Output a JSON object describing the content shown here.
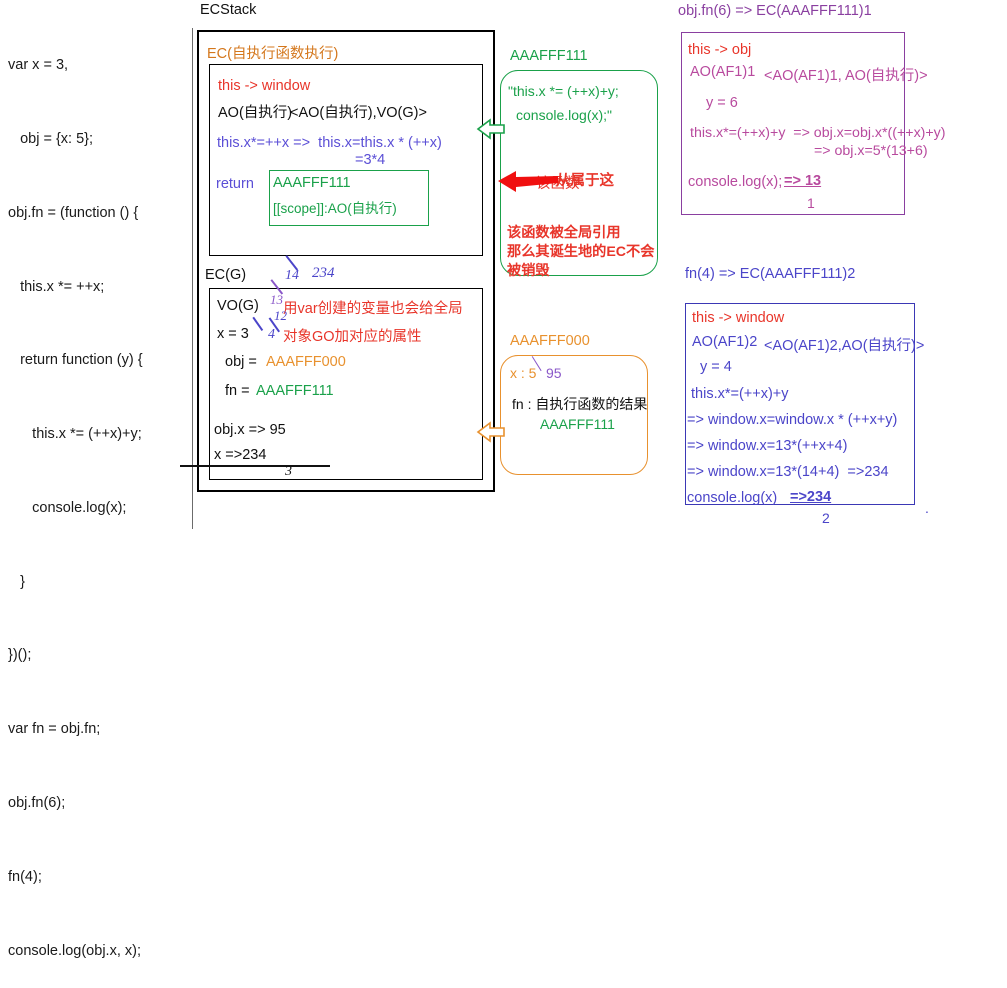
{
  "code_panel": {
    "lines": [
      "var x = 3,",
      "   obj = {x: 5};",
      "obj.fn = (function () {",
      "   this.x *= ++x;",
      "   return function (y) {",
      "      this.x *= (++x)+y;",
      "      console.log(x);",
      "   }",
      "})();",
      "var fn = obj.fn;",
      "obj.fn(6);",
      "fn(4);",
      "console.log(obj.x, x);"
    ]
  },
  "ecstack": {
    "title": "ECStack",
    "ec_self": {
      "label": "EC(自执行函数执行)",
      "this_binding": "this -> window",
      "ao": "AO(自执行)",
      "scope_chain": "<AO(自执行),VO(G)>",
      "expr": "this.x*=++x =>  this.x=this.x * (++x)",
      "expr_result": "=3*4",
      "return_keyword": "return",
      "return_fn_name": "AAAFFF111",
      "return_fn_scope": "[[scope]]:AO(自执行)",
      "belongs_note": "从属于这"
    },
    "ec_g": {
      "label": "EC(G)",
      "vo": "VO(G)",
      "note_line1": "用var创建的变量也会给全局",
      "note_line2": "对象GO加对应的属性",
      "x_line": "x = 3",
      "obj_key": "obj = ",
      "obj_value": "AAAFFF000",
      "fn_key": "fn = ",
      "fn_value": "AAAFFF111",
      "result_objx": "obj.x => 95",
      "result_x": "x =>234",
      "annotations": {
        "a14": "14",
        "a234": "234",
        "a13": "13",
        "a12": "12",
        "a4": "4",
        "a3_bottom": "3"
      }
    }
  },
  "fn111": {
    "label": "AAAFFF111",
    "body_line1": "\"this.x *= (++x)+y;",
    "body_line2": "console.log(x);\"",
    "pointer_label": "该函数",
    "note": "该函数被全局引用\n那么其诞生地的EC不会\n被销毁"
  },
  "obj000": {
    "label": "AAAFFF000",
    "x_line": "x : 5",
    "x_new": "95",
    "fn_line": "fn : 自执行函数的结果",
    "fn_value": "AAAFFF111"
  },
  "call_objfn6": {
    "title": "obj.fn(6) => EC(AAAFFF111)1",
    "this_binding": "this -> obj",
    "ao": "AO(AF1)1",
    "scope_chain": "<AO(AF1)1, AO(自执行)>",
    "y_value": "y = 6",
    "expr": "this.x*=(++x)+y  => obj.x=obj.x*((++x)+y)",
    "expr2": "=> obj.x=5*(13+6)",
    "log_call": "console.log(x);",
    "log_result": "=> 13",
    "log_sub": "1"
  },
  "call_fn4": {
    "title": "fn(4) => EC(AAAFFF111)2",
    "this_binding": "this -> window",
    "ao": "AO(AF1)2",
    "scope_chain": "<AO(AF1)2,AO(自执行)>",
    "y_value": "y = 4",
    "expr1": "this.x*=(++x)+y",
    "expr2": "=> window.x=window.x * (++x+y)",
    "expr3": "=> window.x=13*(++x+4)",
    "expr4": "=> window.x=13*(14+4)  =>234",
    "log_call": "console.log(x)",
    "log_result": "=>234",
    "log_sub": "2",
    "trailing_dot": "."
  },
  "colors": {
    "red": "#e8352a",
    "green": "#1aa14a",
    "orange": "#e8912e",
    "purple": "#8a3fa0",
    "magenta": "#b84a9e",
    "blue": "#4b45c9",
    "black": "#111111"
  }
}
